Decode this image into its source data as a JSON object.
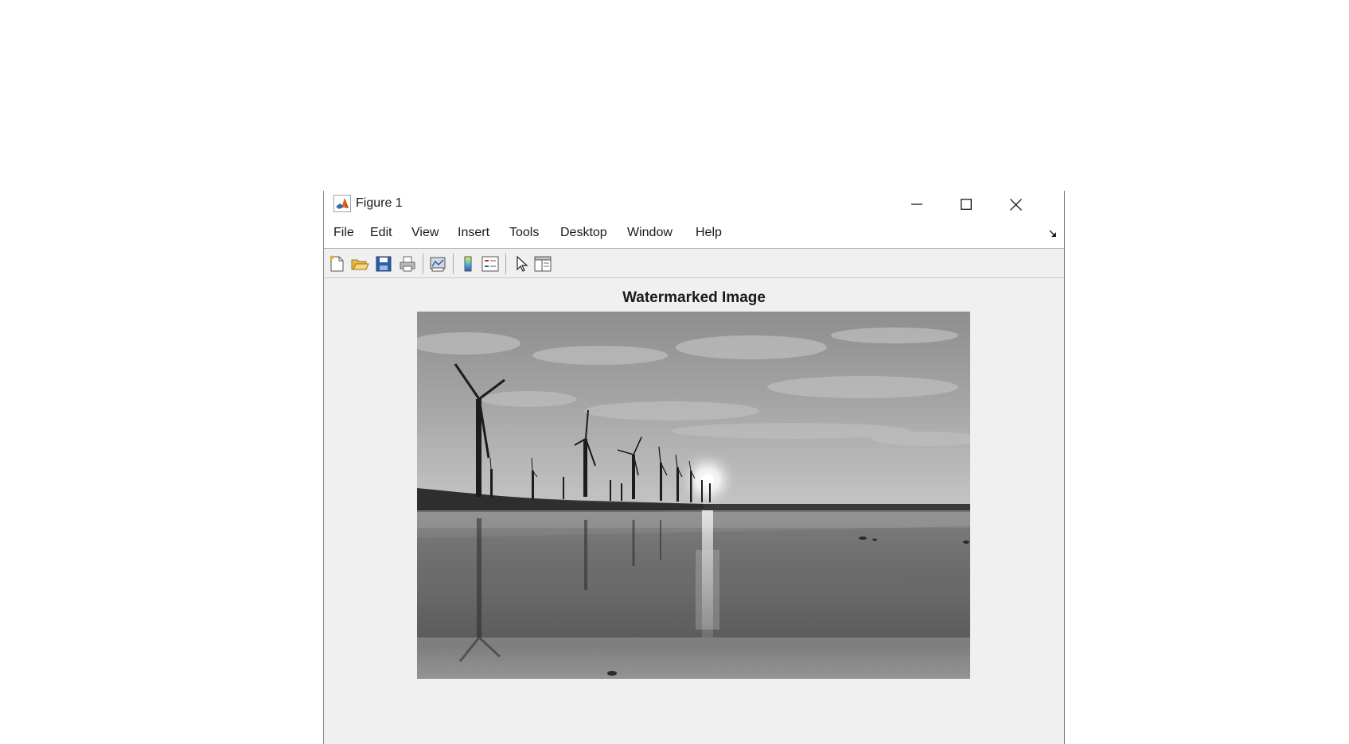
{
  "window": {
    "title": "Figure 1",
    "controls": [
      "minimize-icon",
      "maximize-icon",
      "close-icon"
    ]
  },
  "menubar": {
    "items": [
      "File",
      "Edit",
      "View",
      "Insert",
      "Tools",
      "Desktop",
      "Window",
      "Help"
    ]
  },
  "toolbar": {
    "buttons": [
      "new-figure-icon",
      "open-file-icon",
      "save-icon",
      "print-icon",
      "link-plot-icon",
      "insert-colorbar-icon",
      "insert-legend-icon",
      "edit-plot-arrow-icon",
      "property-inspector-icon"
    ]
  },
  "axes": {
    "title": "Watermarked Image"
  },
  "colors": {
    "window_bg": "#f0f0f0",
    "titlebar_bg": "#ffffff",
    "text": "#1a1a1a"
  }
}
